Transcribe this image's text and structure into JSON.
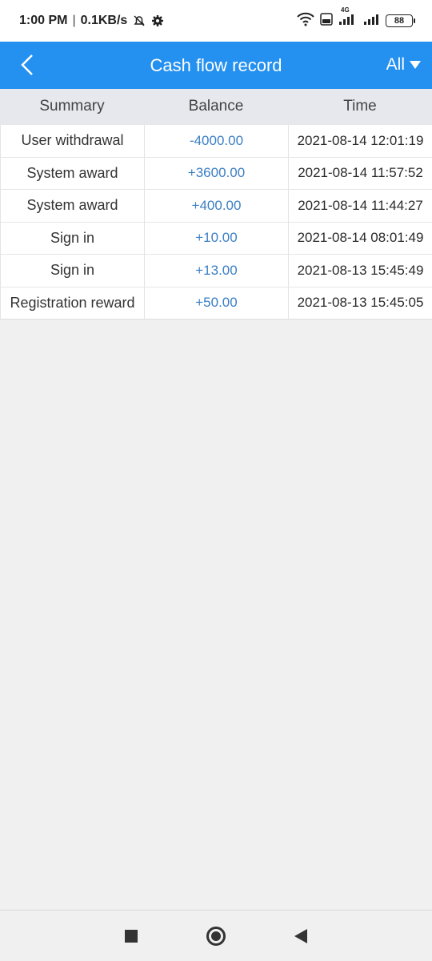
{
  "status_bar": {
    "time": "1:00 PM",
    "network_speed": "0.1KB/s",
    "battery": "88",
    "network_type": "4G"
  },
  "app_bar": {
    "title": "Cash flow record",
    "filter_label": "All"
  },
  "table": {
    "headers": [
      "Summary",
      "Balance",
      "Time"
    ],
    "rows": [
      {
        "summary": "User withdrawal",
        "balance": "-4000.00",
        "time": "2021-08-14 12:01:19"
      },
      {
        "summary": "System award",
        "balance": "+3600.00",
        "time": "2021-08-14 11:57:52"
      },
      {
        "summary": "System award",
        "balance": "+400.00",
        "time": "2021-08-14 11:44:27"
      },
      {
        "summary": "Sign in",
        "balance": "+10.00",
        "time": "2021-08-14 08:01:49"
      },
      {
        "summary": "Sign in",
        "balance": "+13.00",
        "time": "2021-08-13 15:45:49"
      },
      {
        "summary": "Registration reward",
        "balance": "+50.00",
        "time": "2021-08-13 15:45:05"
      }
    ]
  },
  "colors": {
    "accent": "#2490f0",
    "balance_text": "#3b7fc4",
    "header_bg": "#e6e8ed",
    "page_bg": "#f0f0f0"
  }
}
